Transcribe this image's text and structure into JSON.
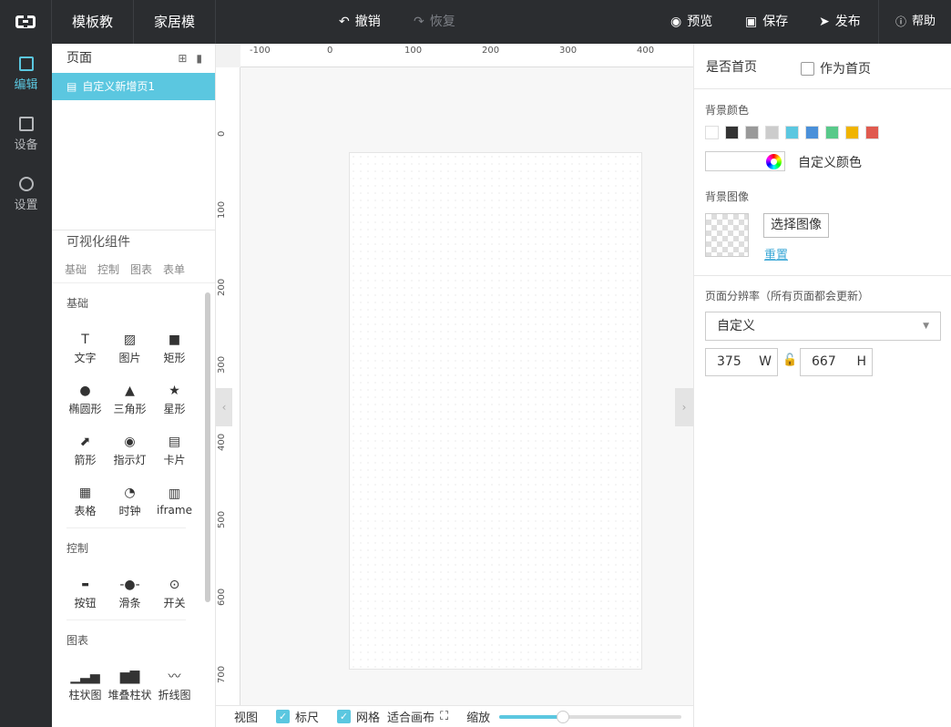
{
  "topbar": {
    "crumbs": [
      "模板教程",
      "家居模板"
    ],
    "undo": "撤销",
    "redo": "恢复",
    "preview": "预览",
    "save": "保存",
    "publish": "发布",
    "help": "帮助"
  },
  "nav": {
    "items": [
      {
        "label": "编辑",
        "icon": "edit-icon"
      },
      {
        "label": "设备",
        "icon": "device-icon"
      },
      {
        "label": "设置",
        "icon": "settings-icon"
      }
    ]
  },
  "pages": {
    "title": "页面",
    "items": [
      "自定义新增页1"
    ]
  },
  "components": {
    "title": "可视化组件",
    "tabs": [
      "基础",
      "控制",
      "图表",
      "表单"
    ],
    "sections": {
      "basic": {
        "title": "基础",
        "items": [
          "文字",
          "图片",
          "矩形",
          "椭圆形",
          "三角形",
          "星形",
          "箭形",
          "指示灯",
          "卡片",
          "表格",
          "时钟",
          "iframe"
        ]
      },
      "control": {
        "title": "控制",
        "items": [
          "按钮",
          "滑条",
          "开关"
        ]
      },
      "chart": {
        "title": "图表",
        "items": [
          "柱状图",
          "堆叠柱状",
          "折线图"
        ]
      }
    }
  },
  "rulers": {
    "top": [
      "-100",
      "0",
      "100",
      "200",
      "300",
      "400"
    ],
    "left": [
      "0",
      "100",
      "200",
      "300",
      "400",
      "500",
      "600",
      "700"
    ]
  },
  "bottombar": {
    "view": "视图",
    "ruler": "标尺",
    "grid": "网格",
    "fit": "适合画布",
    "zoom": "缩放",
    "zoom_level": 0.35
  },
  "props": {
    "home_label": "是否首页",
    "home_checkbox": "作为首页",
    "bg_color_label": "背景颜色",
    "swatches": [
      "#ffffff",
      "#333333",
      "#999999",
      "#cccccc",
      "#5bc7e0",
      "#4a90d9",
      "#58c98a",
      "#f0b400",
      "#e05a4f"
    ],
    "custom_color": "自定义颜色",
    "bg_image_label": "背景图像",
    "select_image": "选择图像",
    "reset": "重置",
    "resolution_label": "页面分辨率（所有页面都会更新）",
    "resolution_value": "自定义",
    "width": "375",
    "width_unit": "W",
    "height": "667",
    "height_unit": "H"
  }
}
